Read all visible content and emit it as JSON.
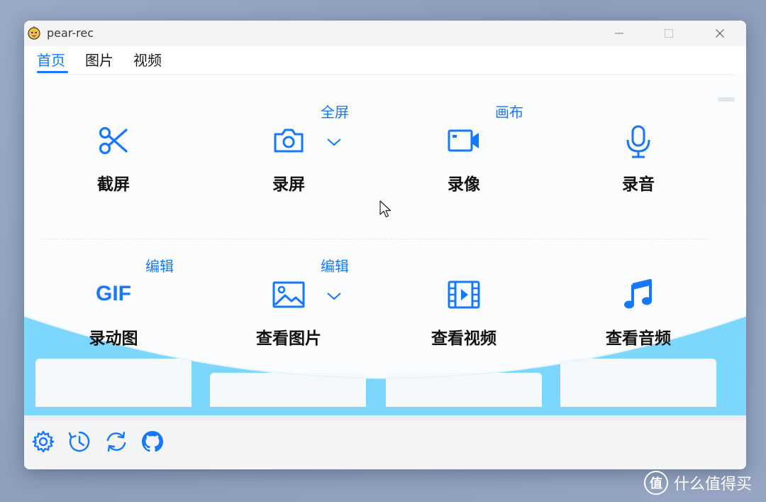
{
  "window": {
    "title": "pear-rec"
  },
  "tabs": [
    {
      "label": "首页",
      "active": true
    },
    {
      "label": "图片",
      "active": false
    },
    {
      "label": "视频",
      "active": false
    }
  ],
  "features": {
    "screenshot": {
      "label": "截屏",
      "icon": "scissors-icon"
    },
    "screen_record": {
      "label": "录屏",
      "icon": "camera-icon",
      "extra": "全屏"
    },
    "camera_record": {
      "label": "录像",
      "icon": "video-camera-icon",
      "extra": "画布"
    },
    "audio_record": {
      "label": "录音",
      "icon": "microphone-icon"
    },
    "gif_record": {
      "label": "录动图",
      "icon_text": "GIF",
      "extra": "编辑"
    },
    "view_images": {
      "label": "查看图片",
      "icon": "image-icon",
      "extra": "编辑"
    },
    "view_videos": {
      "label": "查看视频",
      "icon": "film-play-icon"
    },
    "view_audio": {
      "label": "查看音频",
      "icon": "music-note-icon"
    }
  },
  "bottom_icons": [
    "gear-icon",
    "history-clock-icon",
    "refresh-icon",
    "github-icon"
  ],
  "watermark": {
    "logo_char": "值",
    "text": "什么值得买"
  },
  "colors": {
    "accent": "#1677ff",
    "wave": "#7dd6fb",
    "content_bg": "#fbfcfd",
    "desktop": "#9aa9c4"
  }
}
